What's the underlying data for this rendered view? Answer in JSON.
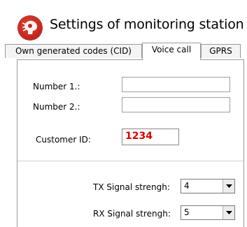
{
  "header": {
    "title": "Settings of monitoring station",
    "logo_icon": "station-logo-icon"
  },
  "tabs": [
    {
      "label": "Own generated codes (CID)",
      "active": false
    },
    {
      "label": "Voice call",
      "active": true
    },
    {
      "label": "GPRS",
      "active": false
    }
  ],
  "voice_call": {
    "number1_label": "Number 1.:",
    "number1_value": "",
    "number2_label": "Number 2.:",
    "number2_value": "",
    "customer_id_label": "Customer ID:",
    "customer_id_value": "1234",
    "tx_label": "TX Signal strengh:",
    "tx_value": "4",
    "rx_label": "RX Signal strengh:",
    "rx_value": "5"
  },
  "colors": {
    "customer_id_text": "#e00000",
    "logo_red": "#c8281d"
  },
  "icons": [
    "station-logo-icon",
    "chevron-down-icon"
  ]
}
